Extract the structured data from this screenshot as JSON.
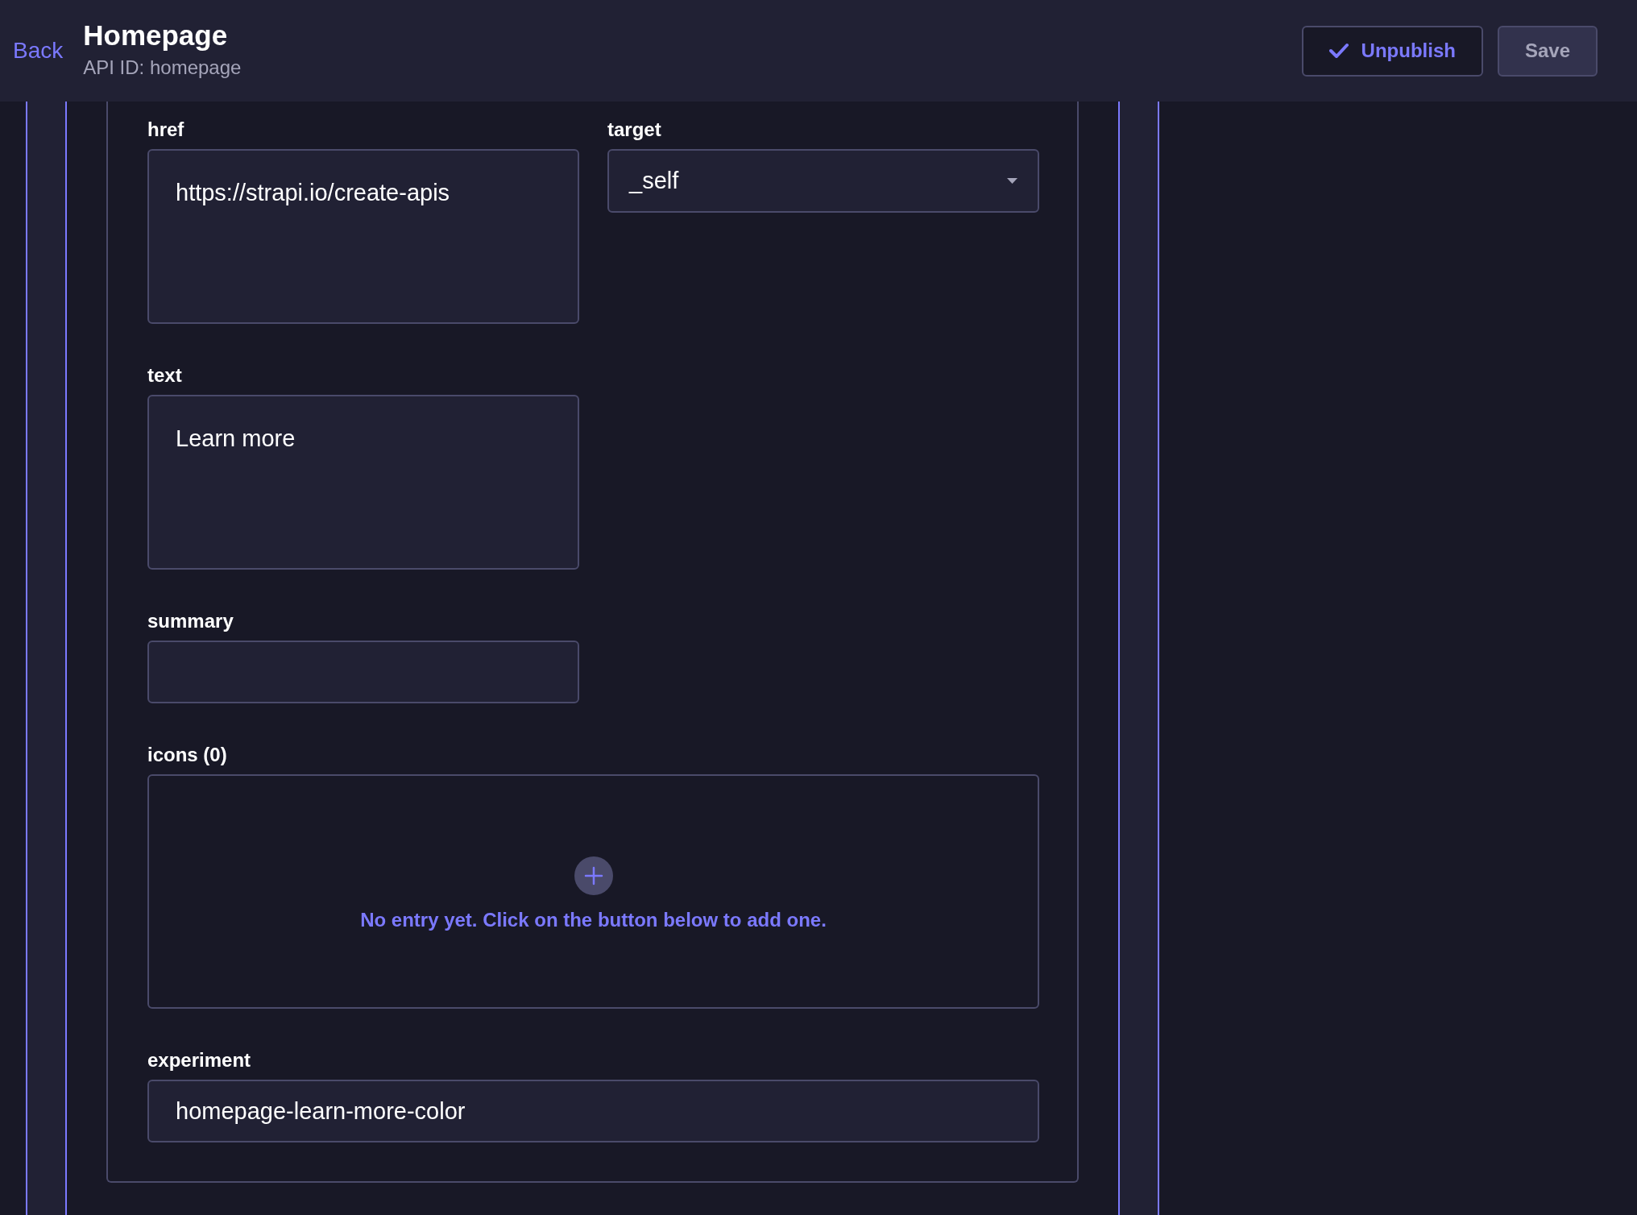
{
  "header": {
    "back_link": "Back",
    "title": "Homepage",
    "subtitle": "API ID: homepage",
    "buttons": [
      {
        "kind": "unpublish",
        "label": "Unpublish",
        "disabled": false
      },
      {
        "kind": "save",
        "label": "Save",
        "disabled": true
      }
    ]
  },
  "form": {
    "rows": [
      {
        "fields": [
          {
            "kind": "textarea",
            "full_width": false,
            "label": "href",
            "value": "https://strapi.io/create-apis"
          },
          {
            "kind": "select",
            "full_width": false,
            "label": "target",
            "value": "_self"
          }
        ]
      },
      {
        "fields": [
          {
            "kind": "textarea",
            "full_width": false,
            "label": "text",
            "value": "Learn more"
          }
        ]
      },
      {
        "fields": [
          {
            "kind": "input",
            "full_width": false,
            "label": "summary"
          }
        ]
      },
      {
        "fields": [
          {
            "kind": "repeatable",
            "full_width": true,
            "label": "icons (0)",
            "empty_message": "No entry yet. Click on the button below to add one."
          }
        ]
      },
      {
        "fields": [
          {
            "kind": "input",
            "full_width": true,
            "label": "experiment",
            "value": "homepage-learn-more-color"
          }
        ]
      }
    ]
  }
}
